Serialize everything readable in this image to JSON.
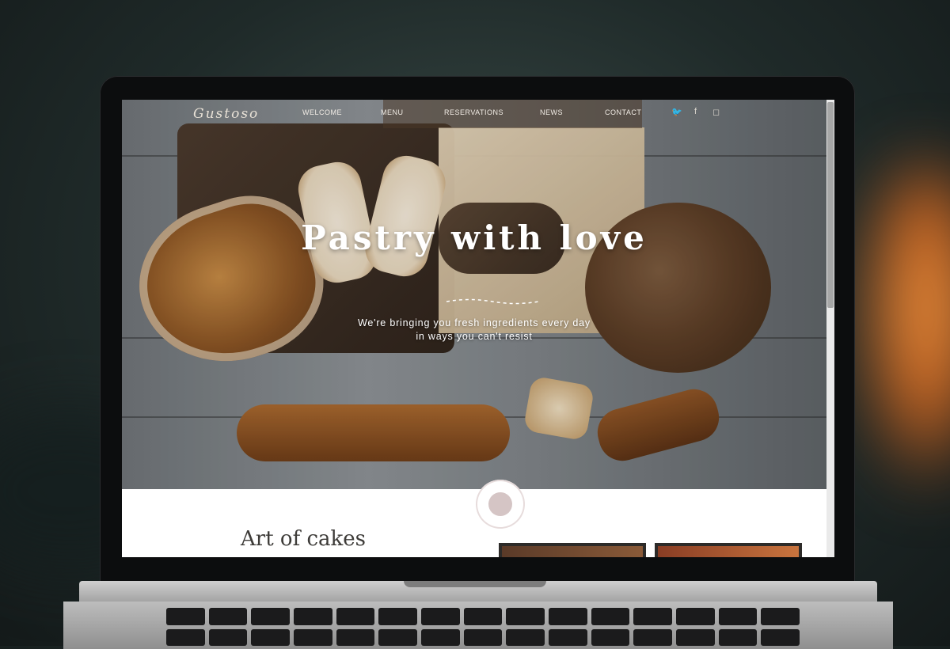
{
  "site": {
    "logo": "Gustoso",
    "nav": [
      {
        "label": "WELCOME"
      },
      {
        "label": "MENU"
      },
      {
        "label": "RESERVATIONS"
      },
      {
        "label": "NEWS"
      },
      {
        "label": "CONTACT"
      }
    ],
    "social_icons": [
      "twitter-icon",
      "facebook-icon",
      "instagram-icon"
    ],
    "social_glyphs": [
      "🐦",
      "f",
      "◻"
    ]
  },
  "hero": {
    "title": "Pastry with love",
    "subtitle_line1": "We're bringing you fresh ingredients every day",
    "subtitle_line2": "in ways you can't resist"
  },
  "section": {
    "title": "Art of cakes"
  },
  "colors": {
    "nav_active": "#4a3828",
    "hero_text": "#ffffff",
    "title_text": "#3d3b38"
  }
}
